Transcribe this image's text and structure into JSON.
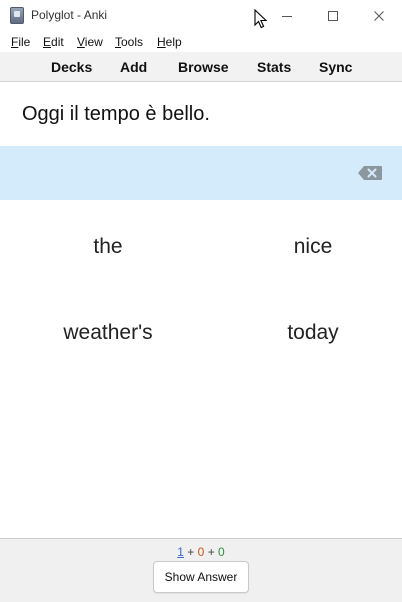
{
  "window": {
    "title": "Polyglot - Anki"
  },
  "menu": [
    {
      "underline": "F",
      "rest": "ile"
    },
    {
      "underline": "E",
      "rest": "dit"
    },
    {
      "underline": "V",
      "rest": "iew"
    },
    {
      "underline": "T",
      "rest": "ools"
    },
    {
      "underline": "H",
      "rest": "elp"
    }
  ],
  "toolbar": {
    "decks": "Decks",
    "add": "Add",
    "browse": "Browse",
    "stats": "Stats",
    "sync": "Sync"
  },
  "card": {
    "sentence": "Oggi il tempo è bello.",
    "answer_band_color": "#d3ebfa",
    "backspace_icon": "backspace-icon",
    "words": [
      "the",
      "nice",
      "weather's",
      "today"
    ]
  },
  "bottom": {
    "count_new": "1",
    "plus": "+",
    "count_learn": "0",
    "count_review": "0",
    "show_answer": "Show Answer"
  }
}
